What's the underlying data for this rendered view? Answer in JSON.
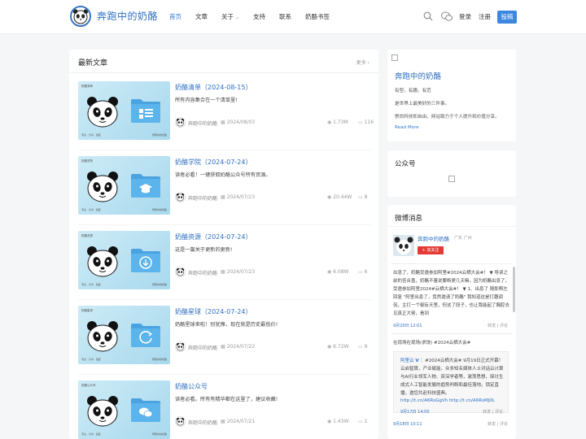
{
  "header": {
    "brand": "奔跑中的奶酪",
    "nav": [
      "首页",
      "文章",
      "关于",
      "支持",
      "联系",
      "奶酪书签"
    ],
    "login": "登录",
    "register": "注册",
    "submit": "投稿",
    "accent": "#2f7ad6"
  },
  "main": {
    "title": "最新文章",
    "more": "更多 ›",
    "posts": [
      {
        "title": "奶酪清单（2024-08-15）",
        "excerpt": "所有内容集合在一个清单里!",
        "author": "奔跑中的奶酪",
        "date": "2024/08/03",
        "views": "1.73M",
        "comments": "116",
        "thumb_title": "奶酪清单",
        "icon": "folder-grid-icon"
      },
      {
        "title": "奶酪学院（2024-07-24）",
        "excerpt": "读者必看！一键获取奶酪公众号所有资源。",
        "author": "奔跑中的奶酪",
        "date": "2024/07/23",
        "views": "20.44W",
        "comments": "8",
        "thumb_title": "奶酪学院",
        "icon": "folder-graduation-icon"
      },
      {
        "title": "奶酪资源（2024-07-24）",
        "excerpt": "这是一篇关于更新的更新!",
        "author": "奔跑中的奶酪",
        "date": "2024/07/23",
        "views": "6.08W",
        "comments": "6",
        "thumb_title": "奶酪资源",
        "icon": "folder-download-icon"
      },
      {
        "title": "奶酪星球（2024-07-24）",
        "excerpt": "奶酪星球来啦！别犹豫，现在就是历史最低价!",
        "author": "奔跑中的奶酪",
        "date": "2024/07/22",
        "views": "6.72W",
        "comments": "9",
        "thumb_title": "奶酪星球",
        "icon": "folder-refresh-icon"
      },
      {
        "title": "奶酪公众号",
        "excerpt": "读者必看。所有有精华都在这里了，建议收藏!",
        "author": "奔跑中的奶酪",
        "date": "2024/07/21",
        "views": "1.43W",
        "comments": "1",
        "thumb_title": "奶酪公众号",
        "icon": "folder-wechat-icon"
      }
    ],
    "thumb_foot": "专注 · 分享 · 改变",
    "thumb_foot2": "奔跑中的奶酪"
  },
  "sidebar": {
    "about": {
      "site_name": "奔跑中的奶酪",
      "lines": [
        "有型。有趣。有范",
        "是世界上最美好的三件事。",
        "崇尚科技和自由，网站致力于个人提升和价值分享。"
      ],
      "read_more": "Read More"
    },
    "official": {
      "title": "公众号"
    },
    "weibo": {
      "title": "微博消息",
      "name": "奔跑中的奶酪",
      "location": "广东 广州",
      "follow": "+ 加关注",
      "post1": "出息了，奶酪受邀参加阿里#2024云栖大会#！ ▼ 导读之前的答合盖，奶酪不量说要断更几天嘛，因为奶酪出息了，受邀参加阿里2024#云栖大会#！ ▼ 1、出息了 随即啊左回复 \"阿里出息了，竟然邀请了奶酪\" 我知道这是打趣调侃，主打一个御反天里，但这了段子，也让我能起了胸腔去见真正大佬，看到",
      "post1_time": "9月20日 12:01",
      "post1_actions": "转发 | 评论",
      "post2": "在现场在现场(求饶) #2024云栖大会#",
      "repost_name": "阿里云",
      "repost_text": "：#2024云栖大会# 9月19日正式开幕！云启智算，产业赋能，众多知名媒体人士对话云计算与AI行业领军人物、资深学者等，激荡思想，探讨生成式人工智能发展的趋势判断和最佳落地。锁定直播，邀您共赴科技盛典。",
      "repost_links": "http://t.cn/A6RsGgVh http://t.cn/A6RsMJ0L",
      "repost_time": "9月17日 14:00",
      "repost_actions": "转发 | 评论",
      "post2_time": "9月18日 10:11",
      "post2_actions": "转发 | 评论"
    }
  }
}
